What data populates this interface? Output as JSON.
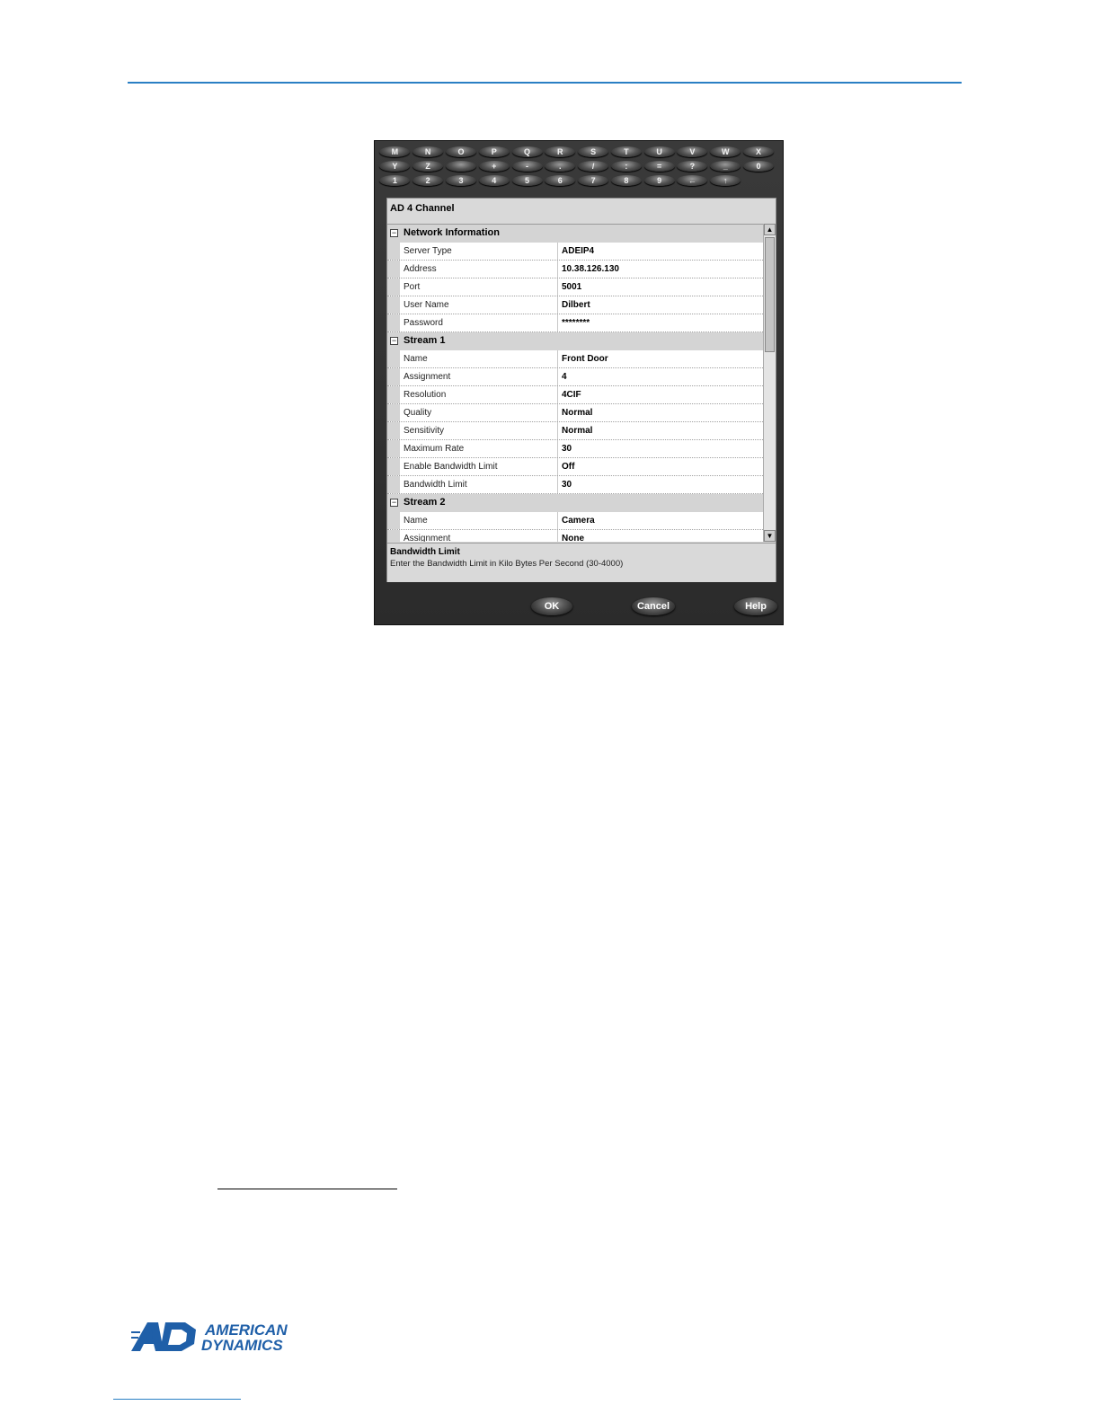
{
  "keyboard": {
    "row1": [
      "M",
      "N",
      "O",
      "P",
      "Q",
      "R",
      "S",
      "T",
      "U",
      "V",
      "W",
      "X"
    ],
    "row2": [
      "Y",
      "Z",
      "",
      "+",
      "-",
      ".",
      "/",
      ":",
      "=",
      "?",
      "_",
      "0"
    ],
    "row3": [
      "1",
      "2",
      "3",
      "4",
      "5",
      "6",
      "7",
      "8",
      "9",
      "←",
      "↑"
    ]
  },
  "dialog": {
    "title": "AD 4 Channel",
    "categories": [
      {
        "label": "Network Information",
        "rows": [
          {
            "name": "Server Type",
            "value": "ADEIP4"
          },
          {
            "name": "Address",
            "value": "10.38.126.130"
          },
          {
            "name": "Port",
            "value": "5001"
          },
          {
            "name": "User Name",
            "value": "Dilbert"
          },
          {
            "name": "Password",
            "value": "********"
          }
        ]
      },
      {
        "label": "Stream 1",
        "rows": [
          {
            "name": "Name",
            "value": "Front Door"
          },
          {
            "name": "Assignment",
            "value": "4"
          },
          {
            "name": "Resolution",
            "value": "4CIF"
          },
          {
            "name": "Quality",
            "value": "Normal"
          },
          {
            "name": "Sensitivity",
            "value": "Normal"
          },
          {
            "name": "Maximum Rate",
            "value": "30"
          },
          {
            "name": "Enable Bandwidth Limit",
            "value": "Off"
          },
          {
            "name": "Bandwidth Limit",
            "value": "30"
          }
        ]
      },
      {
        "label": "Stream 2",
        "rows": [
          {
            "name": "Name",
            "value": "Camera"
          },
          {
            "name": "Assignment",
            "value": "None"
          }
        ]
      }
    ],
    "help_title": "Bandwidth Limit",
    "help_text": "Enter the Bandwidth Limit in Kilo Bytes Per Second (30-4000)",
    "buttons": {
      "ok": "OK",
      "cancel": "Cancel",
      "help": "Help"
    }
  },
  "logo": {
    "line1": "AMERICAN",
    "line2": "DYNAMICS",
    "mark": "AD",
    "color": "#1f5fa8"
  },
  "accent_color": "#2a7fc4"
}
